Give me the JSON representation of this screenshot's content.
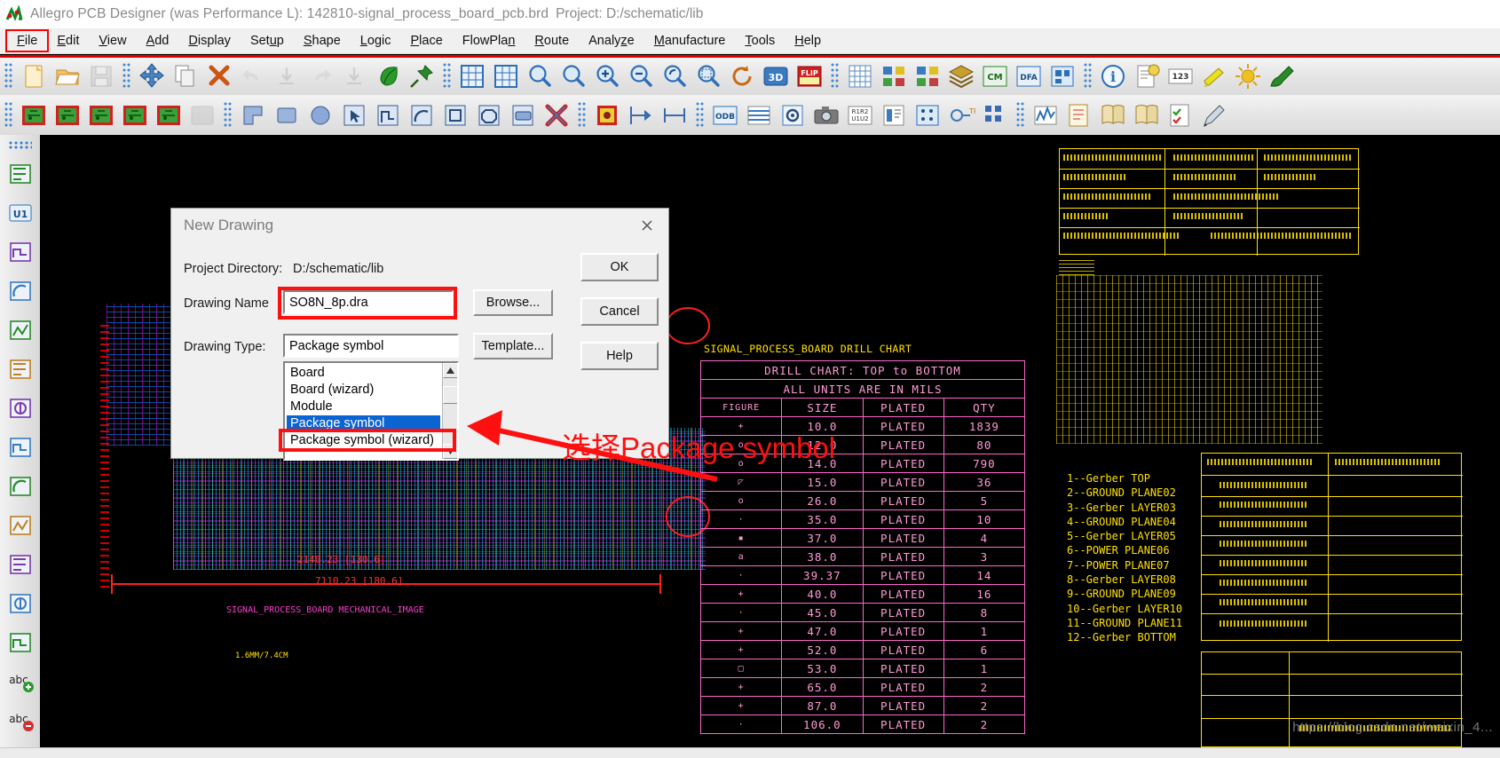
{
  "window": {
    "title": "Allegro PCB Designer (was Performance L): 142810-signal_process_board_pcb.brd",
    "project_label": "Project: D:/schematic/lib",
    "app_icon": "allegro-icon"
  },
  "menubar": {
    "items": [
      {
        "label": "File",
        "accel": "F",
        "selected": true
      },
      {
        "label": "Edit",
        "accel": "E",
        "selected": false
      },
      {
        "label": "View",
        "accel": "V",
        "selected": false
      },
      {
        "label": "Add",
        "accel": "A",
        "selected": false
      },
      {
        "label": "Display",
        "accel": "D",
        "selected": false
      },
      {
        "label": "Setup",
        "accel": "u",
        "selected": false
      },
      {
        "label": "Shape",
        "accel": "S",
        "selected": false
      },
      {
        "label": "Logic",
        "accel": "L",
        "selected": false
      },
      {
        "label": "Place",
        "accel": "P",
        "selected": false
      },
      {
        "label": "FlowPlan",
        "accel": "n",
        "selected": false
      },
      {
        "label": "Route",
        "accel": "R",
        "selected": false
      },
      {
        "label": "Analyze",
        "accel": "z",
        "selected": false
      },
      {
        "label": "Manufacture",
        "accel": "M",
        "selected": false
      },
      {
        "label": "Tools",
        "accel": "T",
        "selected": false
      },
      {
        "label": "Help",
        "accel": "H",
        "selected": false
      }
    ]
  },
  "toolbar_row1": [
    {
      "name": "new-file-icon",
      "glyph": "page",
      "color": "#f0c97a",
      "enabled": true
    },
    {
      "name": "open-folder-icon",
      "glyph": "folder",
      "color": "#e8a53c",
      "enabled": true
    },
    {
      "name": "save-icon",
      "glyph": "floppy",
      "color": "#b9b9b9",
      "enabled": false
    },
    {
      "name": "move-icon",
      "glyph": "move",
      "color": "#2f6fb8",
      "enabled": true
    },
    {
      "name": "copy-icon",
      "glyph": "copy",
      "color": "#9a9a9a",
      "enabled": true
    },
    {
      "name": "delete-icon",
      "glyph": "cross",
      "color": "#cc5414",
      "enabled": true
    },
    {
      "name": "undo-icon",
      "glyph": "undo",
      "color": "#c5c5c5",
      "enabled": false
    },
    {
      "name": "undo-step-icon",
      "glyph": "arrow-down",
      "color": "#c5c5c5",
      "enabled": false
    },
    {
      "name": "redo-icon",
      "glyph": "redo",
      "color": "#c5c5c5",
      "enabled": false
    },
    {
      "name": "redo-step-icon",
      "glyph": "arrow-down",
      "color": "#c5c5c5",
      "enabled": false
    },
    {
      "name": "shape-fill-icon",
      "glyph": "leaf",
      "color": "#2a9a2a",
      "enabled": true
    },
    {
      "name": "pin-icon",
      "glyph": "pin",
      "color": "#2a8a2a",
      "enabled": true
    },
    {
      "name": "zoom-fit-icon",
      "glyph": "grid-box",
      "color": "#2f6fb8",
      "enabled": true
    },
    {
      "name": "zoom-world-icon",
      "glyph": "grid-box2",
      "color": "#2f6fb8",
      "enabled": true
    },
    {
      "name": "zoom-by-points-icon",
      "glyph": "mag",
      "color": "#2f6fb8",
      "enabled": true
    },
    {
      "name": "zoom-fit-window-icon",
      "glyph": "mag",
      "color": "#2f6fb8",
      "enabled": true
    },
    {
      "name": "zoom-in-icon",
      "glyph": "mag-plus",
      "color": "#2f6fb8",
      "enabled": true
    },
    {
      "name": "zoom-out-icon",
      "glyph": "mag-minus",
      "color": "#2f6fb8",
      "enabled": true
    },
    {
      "name": "zoom-previous-icon",
      "glyph": "mag-prev",
      "color": "#2f6fb8",
      "enabled": true
    },
    {
      "name": "zoom-region-icon",
      "glyph": "mag-region",
      "color": "#2f6fb8",
      "enabled": true
    },
    {
      "name": "refresh-icon",
      "glyph": "refresh",
      "color": "#c86a14",
      "enabled": true
    },
    {
      "name": "view-3d-icon",
      "glyph": "3D",
      "color": "#2a6fb8",
      "enabled": true
    },
    {
      "name": "flip-design-icon",
      "glyph": "FLIP",
      "color": "#d02020",
      "enabled": true
    },
    {
      "name": "grid-toggle-icon",
      "glyph": "grid",
      "color": "#5a8ac0",
      "enabled": true
    },
    {
      "name": "color-palette-icon",
      "glyph": "colors",
      "color": "#3a7ac0",
      "enabled": true
    },
    {
      "name": "color192-icon",
      "glyph": "colors2",
      "color": "#3a7ac0",
      "enabled": true
    },
    {
      "name": "layers-icon",
      "glyph": "layers",
      "color": "#c8a030",
      "enabled": true
    },
    {
      "name": "constraint-manager-icon",
      "glyph": "CM",
      "color": "#2a8a2a",
      "enabled": true
    },
    {
      "name": "dfa-icon",
      "glyph": "DFA",
      "color": "#2a6fb8",
      "enabled": true
    },
    {
      "name": "db-check-icon",
      "glyph": "dbcheck",
      "color": "#2a6fb8",
      "enabled": true
    },
    {
      "name": "info-icon",
      "glyph": "info",
      "color": "#2a6fb8",
      "enabled": true
    },
    {
      "name": "report-icon",
      "glyph": "report",
      "color": "#c8a030",
      "enabled": true
    },
    {
      "name": "measure-icon",
      "glyph": "123",
      "color": "#c8a030",
      "enabled": true
    },
    {
      "name": "highlight-icon",
      "glyph": "highlight",
      "color": "#c8c020",
      "enabled": true
    },
    {
      "name": "dehighlight-icon",
      "glyph": "sun",
      "color": "#e0b020",
      "enabled": true
    },
    {
      "name": "assign-color-icon",
      "glyph": "brush",
      "color": "#2a8a2a",
      "enabled": true
    }
  ],
  "toolbar_row2": [
    {
      "name": "shape-add-rect-icon",
      "glyph": "gs1",
      "enabled": true
    },
    {
      "name": "shape-select-icon",
      "glyph": "gs2",
      "enabled": true
    },
    {
      "name": "shape-edit-icon",
      "glyph": "gs3",
      "enabled": true
    },
    {
      "name": "shape-merge-icon",
      "glyph": "gs4",
      "enabled": true
    },
    {
      "name": "shape-check-icon",
      "glyph": "gs5",
      "enabled": true
    },
    {
      "name": "shape-delete-icon",
      "glyph": "gsoff",
      "enabled": false
    },
    {
      "name": "add-line-icon",
      "glyph": "bl1",
      "enabled": true
    },
    {
      "name": "add-rect-icon",
      "glyph": "bl2",
      "enabled": true
    },
    {
      "name": "add-circle-icon",
      "glyph": "bl3",
      "enabled": true
    },
    {
      "name": "select-arrow-icon",
      "glyph": "bl4",
      "enabled": true
    },
    {
      "name": "add-polygon-icon",
      "glyph": "bl5",
      "enabled": true
    },
    {
      "name": "add-arc-icon",
      "glyph": "bl6",
      "enabled": true
    },
    {
      "name": "add-square-icon",
      "glyph": "bl7",
      "enabled": true
    },
    {
      "name": "add-octagon-icon",
      "glyph": "bl8",
      "enabled": true
    },
    {
      "name": "add-shape-icon",
      "glyph": "bl9",
      "enabled": true
    },
    {
      "name": "delete-shape-icon",
      "glyph": "xred",
      "enabled": true
    },
    {
      "name": "place-manual-icon",
      "glyph": "place",
      "enabled": true
    },
    {
      "name": "dimension-left-icon",
      "glyph": "dim1",
      "enabled": true
    },
    {
      "name": "dimension-icon",
      "glyph": "dim2",
      "enabled": true
    },
    {
      "name": "odb-export-icon",
      "glyph": "ODB",
      "enabled": true
    },
    {
      "name": "cross-section-icon",
      "glyph": "xsec",
      "enabled": true
    },
    {
      "name": "padstack-icon",
      "glyph": "pad",
      "enabled": true
    },
    {
      "name": "photo-plot-icon",
      "glyph": "camera",
      "enabled": true
    },
    {
      "name": "ref-des-icon",
      "glyph": "R1R2",
      "enabled": true
    },
    {
      "name": "text-icon",
      "glyph": "textb",
      "enabled": true
    },
    {
      "name": "drill-legend-icon",
      "glyph": "drill",
      "enabled": true
    },
    {
      "name": "testpoint-icon",
      "glyph": "tp",
      "enabled": true
    },
    {
      "name": "array-icon",
      "glyph": "array",
      "enabled": true
    },
    {
      "name": "signal-analysis-icon",
      "glyph": "wave",
      "enabled": true
    },
    {
      "name": "notes-icon",
      "glyph": "notes",
      "enabled": true
    },
    {
      "name": "book-icon",
      "glyph": "book",
      "enabled": true
    },
    {
      "name": "book2-icon",
      "glyph": "book2",
      "enabled": true
    },
    {
      "name": "checklist-icon",
      "glyph": "check",
      "enabled": true
    },
    {
      "name": "pen-icon",
      "glyph": "pen",
      "enabled": true
    }
  ],
  "leftbar": [
    {
      "name": "placement-edit-icon",
      "glyph": "lb1"
    },
    {
      "name": "ref-des-u1-icon",
      "glyph": "U1"
    },
    {
      "name": "component-icon",
      "glyph": "lb3"
    },
    {
      "name": "route-connect-icon",
      "glyph": "lb4"
    },
    {
      "name": "slide-icon",
      "glyph": "lb5"
    },
    {
      "name": "vertex-icon",
      "glyph": "lb6"
    },
    {
      "name": "delay-tune-icon",
      "glyph": "lb7"
    },
    {
      "name": "custom-smooth-icon",
      "glyph": "lb8"
    },
    {
      "name": "spread-between-voids-icon",
      "glyph": "lb9"
    },
    {
      "name": "contour-icon",
      "glyph": "lb10"
    },
    {
      "name": "dashed-line-icon",
      "glyph": "lb11"
    },
    {
      "name": "line-icon",
      "glyph": "lb12"
    },
    {
      "name": "rectangle-icon",
      "glyph": "lb13"
    },
    {
      "name": "text-abc-icon",
      "glyph": "abc"
    },
    {
      "name": "text-abc-delete-icon",
      "glyph": "abc2"
    }
  ],
  "dialog": {
    "title": "New Drawing",
    "close_icon": "close-icon",
    "project_directory_label": "Project Directory:",
    "project_directory_value": "D:/schematic/lib",
    "drawing_name_label": "Drawing Name",
    "drawing_name_value": "SO8N_8p.dra",
    "drawing_type_label": "Drawing Type:",
    "drawing_type_value": "Package symbol",
    "buttons": {
      "browse": "Browse...",
      "template": "Template...",
      "ok": "OK",
      "cancel": "Cancel",
      "help": "Help"
    },
    "type_options": [
      {
        "label": "Board",
        "selected": false
      },
      {
        "label": "Board (wizard)",
        "selected": false
      },
      {
        "label": "Module",
        "selected": false
      },
      {
        "label": "Package symbol",
        "selected": true
      },
      {
        "label": "Package symbol (wizard)",
        "selected": false
      }
    ],
    "highlight_color": "#ff1010",
    "selection_color": "#0a64d2"
  },
  "annotation": {
    "text": "选择Package symbol",
    "color": "#ff1010",
    "arrow_name": "red-arrow-pointer"
  },
  "canvas": {
    "drill_chart_caption": "SIGNAL_PROCESS_BOARD DRILL CHART",
    "board_dim_text": "7110.23 [180.6]",
    "board_dim_text2": "2140.23 [130.6]",
    "board_note": "SIGNAL_PROCESS_BOARD MECHANICAL_IMAGE",
    "watermark": "https://blog.csdn.net/weixin_4...",
    "colors": {
      "drill_table": "#ff66cc",
      "yellow": "#ffe000",
      "cyan": "#00e5e5",
      "red": "#ff3030"
    }
  },
  "chart_data": {
    "type": "table",
    "title": "DRILL CHART: TOP to BOTTOM",
    "subtitle": "ALL UNITS ARE IN MILS",
    "columns": [
      "FIGURE",
      "SIZE",
      "PLATED",
      "QTY"
    ],
    "rows": [
      {
        "figure": "+",
        "size": "10.0",
        "plated": "PLATED",
        "qty": "1839"
      },
      {
        "figure": "o",
        "size": "12.0",
        "plated": "PLATED",
        "qty": "80"
      },
      {
        "figure": "o",
        "size": "14.0",
        "plated": "PLATED",
        "qty": "790"
      },
      {
        "figure": "◸",
        "size": "15.0",
        "plated": "PLATED",
        "qty": "36"
      },
      {
        "figure": "o",
        "size": "26.0",
        "plated": "PLATED",
        "qty": "5"
      },
      {
        "figure": "·",
        "size": "35.0",
        "plated": "PLATED",
        "qty": "10"
      },
      {
        "figure": "▪",
        "size": "37.0",
        "plated": "PLATED",
        "qty": "4"
      },
      {
        "figure": "a",
        "size": "38.0",
        "plated": "PLATED",
        "qty": "3"
      },
      {
        "figure": "·",
        "size": "39.37",
        "plated": "PLATED",
        "qty": "14"
      },
      {
        "figure": "+",
        "size": "40.0",
        "plated": "PLATED",
        "qty": "16"
      },
      {
        "figure": "·",
        "size": "45.0",
        "plated": "PLATED",
        "qty": "8"
      },
      {
        "figure": "+",
        "size": "47.0",
        "plated": "PLATED",
        "qty": "1"
      },
      {
        "figure": "+",
        "size": "52.0",
        "plated": "PLATED",
        "qty": "6"
      },
      {
        "figure": "□",
        "size": "53.0",
        "plated": "PLATED",
        "qty": "1"
      },
      {
        "figure": "+",
        "size": "65.0",
        "plated": "PLATED",
        "qty": "2"
      },
      {
        "figure": "+",
        "size": "87.0",
        "plated": "PLATED",
        "qty": "2"
      },
      {
        "figure": "·",
        "size": "106.0",
        "plated": "PLATED",
        "qty": "2"
      }
    ]
  },
  "gerber_layers": [
    "1--Gerber TOP",
    "2--GROUND PLANE02",
    "3--Gerber LAYER03",
    "4--GROUND PLANE04",
    "5--Gerber LAYER05",
    "6--POWER PLANE06",
    "7--POWER PLANE07",
    "8--Gerber LAYER08",
    "9--GROUND PLANE09",
    "10--Gerber LAYER10",
    "11--GROUND PLANE11",
    "12--Gerber BOTTOM"
  ]
}
